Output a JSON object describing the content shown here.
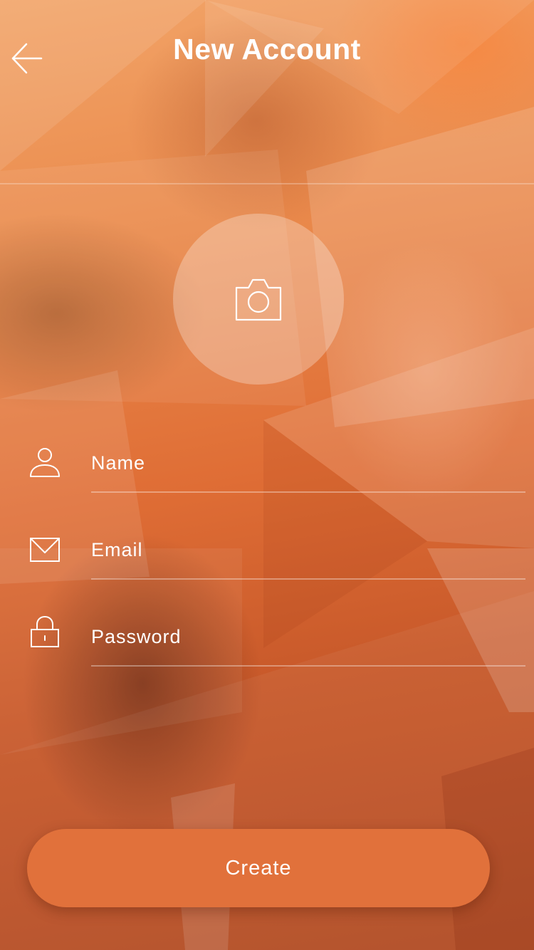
{
  "colors": {
    "accent": "#e1713b",
    "text": "#ffffff",
    "background_top": "#f2a468",
    "background_bottom": "#b04a22"
  },
  "header": {
    "title": "New Account",
    "back_icon": "arrow-left-icon"
  },
  "avatar": {
    "icon": "camera-icon"
  },
  "form": {
    "name": {
      "placeholder": "Name",
      "value": "",
      "icon": "user-icon"
    },
    "email": {
      "placeholder": "Email",
      "value": "",
      "icon": "envelope-icon"
    },
    "password": {
      "placeholder": "Password",
      "value": "",
      "icon": "lock-icon"
    }
  },
  "actions": {
    "create_label": "Create"
  }
}
